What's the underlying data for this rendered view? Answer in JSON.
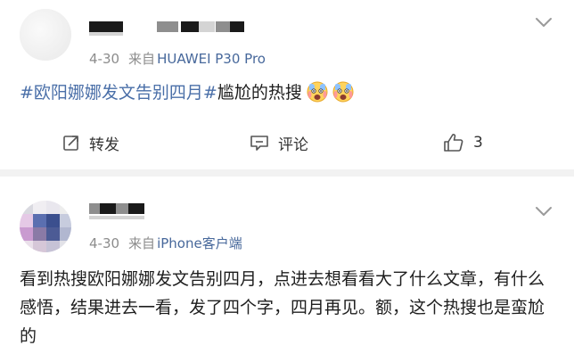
{
  "posts": [
    {
      "date": "4-30",
      "source_prefix": "来自",
      "device": "HUAWEI P30 Pro",
      "hashtag": "#欧阳娜娜发文告别四月#",
      "text": "尴尬的热搜",
      "emoji": "scream-emoji",
      "actions": {
        "repost": "转发",
        "comment": "评论",
        "like_count": "3"
      }
    },
    {
      "date": "4-30",
      "source_prefix": "来自",
      "device": "iPhone客户端",
      "text": "看到热搜欧阳娜娜发文告别四月，点进去想看看大了什么文章，有什么感悟，结果进去一看，发了四个字，四月再见。额，这个热搜也是蛮尬的"
    }
  ],
  "colors": {
    "link": "#4a6fa8",
    "meta": "#8c8c8c",
    "divider": "#f2f2f2"
  }
}
